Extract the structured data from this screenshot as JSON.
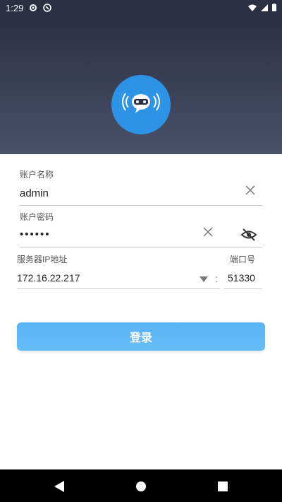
{
  "status_bar": {
    "time": "1:29"
  },
  "form": {
    "username_label": "账户名称",
    "username_value": "admin",
    "password_label": "账户密码",
    "password_value": "••••••",
    "server_ip_label": "服务器IP地址",
    "server_ip_value": "172.16.22.217",
    "port_label": "端口号",
    "port_value": "51330",
    "separator": ":"
  },
  "login_button_label": "登录",
  "colors": {
    "accent": "#2d93e6",
    "header": "#2b2f44",
    "button": "#5ab3f5"
  }
}
